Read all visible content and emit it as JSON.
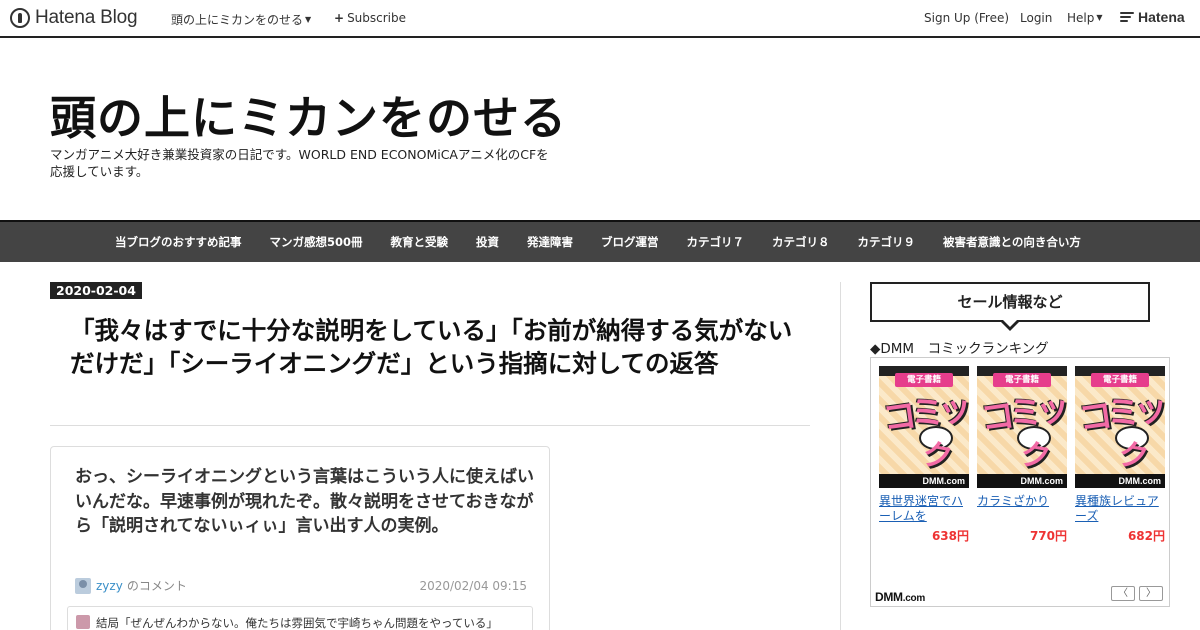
{
  "topbar": {
    "logo_text": "Hatena Blog",
    "blog_menu": "頭の上にミカンをのせる",
    "subscribe": "Subscribe",
    "signup": "Sign Up (Free)",
    "login": "Login",
    "help": "Help",
    "hatena": "Hatena"
  },
  "header": {
    "title": "頭の上にミカンをのせる",
    "description": "マンガアニメ大好き兼業投資家の日記です。WORLD END ECONOMiCAアニメ化のCFを応援しています。"
  },
  "nav": {
    "items": [
      "当ブログのおすすめ記事",
      "マンガ感想500冊",
      "教育と受験",
      "投資",
      "発達障害",
      "ブログ運営",
      "カテゴリ７",
      "カテゴリ８",
      "カテゴリ９",
      "被害者意識との向き合い方"
    ]
  },
  "entry": {
    "date": "2020-02-04",
    "title": "「我々はすでに十分な説明をしている」「お前が納得する気がないだけだ」「シーライオニングだ」という指摘に対しての返答"
  },
  "card": {
    "text": "おっ、シーライオニングという言葉はこういう人に使えばいいんだな。早速事例が現れたぞ。散々説明をさせておきながら「説明されてないぃィぃ」言い出す人の実例。",
    "user": "zyzy",
    "comment_label": "のコメント",
    "time": "2020/02/04 09:15",
    "quote": "結局「ぜんぜんわからない。俺たちは雰囲気で宇崎ちゃん問題をやっている」"
  },
  "sidebar": {
    "heading": "セール情報など",
    "subheading": "◆DMM　コミックランキング",
    "cover_badge": "電子書籍",
    "cover_big": "コミッ",
    "cover_ku": "ク",
    "cover_brand": "DMM.com",
    "items": [
      {
        "title": "異世界迷宮でハーレムを",
        "price": "638円"
      },
      {
        "title": "カラミざかり",
        "price": "770円"
      },
      {
        "title": "異種族レビュアーズ",
        "price": "682円"
      }
    ],
    "dmm_logo": "DMM",
    "dmm_logo_suffix": ".com",
    "prev": "〈",
    "next": "〉"
  },
  "colors": {
    "nav_bg": "#444444",
    "accent_pink": "#e63d8c",
    "link_blue": "#1a5fb4",
    "price_red": "#ee3333"
  }
}
